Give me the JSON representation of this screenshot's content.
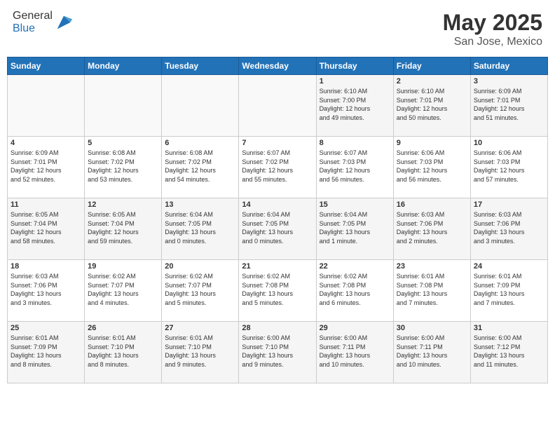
{
  "header": {
    "logo_general": "General",
    "logo_blue": "Blue",
    "month": "May 2025",
    "location": "San Jose, Mexico"
  },
  "days_of_week": [
    "Sunday",
    "Monday",
    "Tuesday",
    "Wednesday",
    "Thursday",
    "Friday",
    "Saturday"
  ],
  "weeks": [
    [
      {
        "day": "",
        "info": ""
      },
      {
        "day": "",
        "info": ""
      },
      {
        "day": "",
        "info": ""
      },
      {
        "day": "",
        "info": ""
      },
      {
        "day": "1",
        "info": "Sunrise: 6:10 AM\nSunset: 7:00 PM\nDaylight: 12 hours\nand 49 minutes."
      },
      {
        "day": "2",
        "info": "Sunrise: 6:10 AM\nSunset: 7:01 PM\nDaylight: 12 hours\nand 50 minutes."
      },
      {
        "day": "3",
        "info": "Sunrise: 6:09 AM\nSunset: 7:01 PM\nDaylight: 12 hours\nand 51 minutes."
      }
    ],
    [
      {
        "day": "4",
        "info": "Sunrise: 6:09 AM\nSunset: 7:01 PM\nDaylight: 12 hours\nand 52 minutes."
      },
      {
        "day": "5",
        "info": "Sunrise: 6:08 AM\nSunset: 7:02 PM\nDaylight: 12 hours\nand 53 minutes."
      },
      {
        "day": "6",
        "info": "Sunrise: 6:08 AM\nSunset: 7:02 PM\nDaylight: 12 hours\nand 54 minutes."
      },
      {
        "day": "7",
        "info": "Sunrise: 6:07 AM\nSunset: 7:02 PM\nDaylight: 12 hours\nand 55 minutes."
      },
      {
        "day": "8",
        "info": "Sunrise: 6:07 AM\nSunset: 7:03 PM\nDaylight: 12 hours\nand 56 minutes."
      },
      {
        "day": "9",
        "info": "Sunrise: 6:06 AM\nSunset: 7:03 PM\nDaylight: 12 hours\nand 56 minutes."
      },
      {
        "day": "10",
        "info": "Sunrise: 6:06 AM\nSunset: 7:03 PM\nDaylight: 12 hours\nand 57 minutes."
      }
    ],
    [
      {
        "day": "11",
        "info": "Sunrise: 6:05 AM\nSunset: 7:04 PM\nDaylight: 12 hours\nand 58 minutes."
      },
      {
        "day": "12",
        "info": "Sunrise: 6:05 AM\nSunset: 7:04 PM\nDaylight: 12 hours\nand 59 minutes."
      },
      {
        "day": "13",
        "info": "Sunrise: 6:04 AM\nSunset: 7:05 PM\nDaylight: 13 hours\nand 0 minutes."
      },
      {
        "day": "14",
        "info": "Sunrise: 6:04 AM\nSunset: 7:05 PM\nDaylight: 13 hours\nand 0 minutes."
      },
      {
        "day": "15",
        "info": "Sunrise: 6:04 AM\nSunset: 7:05 PM\nDaylight: 13 hours\nand 1 minute."
      },
      {
        "day": "16",
        "info": "Sunrise: 6:03 AM\nSunset: 7:06 PM\nDaylight: 13 hours\nand 2 minutes."
      },
      {
        "day": "17",
        "info": "Sunrise: 6:03 AM\nSunset: 7:06 PM\nDaylight: 13 hours\nand 3 minutes."
      }
    ],
    [
      {
        "day": "18",
        "info": "Sunrise: 6:03 AM\nSunset: 7:06 PM\nDaylight: 13 hours\nand 3 minutes."
      },
      {
        "day": "19",
        "info": "Sunrise: 6:02 AM\nSunset: 7:07 PM\nDaylight: 13 hours\nand 4 minutes."
      },
      {
        "day": "20",
        "info": "Sunrise: 6:02 AM\nSunset: 7:07 PM\nDaylight: 13 hours\nand 5 minutes."
      },
      {
        "day": "21",
        "info": "Sunrise: 6:02 AM\nSunset: 7:08 PM\nDaylight: 13 hours\nand 5 minutes."
      },
      {
        "day": "22",
        "info": "Sunrise: 6:02 AM\nSunset: 7:08 PM\nDaylight: 13 hours\nand 6 minutes."
      },
      {
        "day": "23",
        "info": "Sunrise: 6:01 AM\nSunset: 7:08 PM\nDaylight: 13 hours\nand 7 minutes."
      },
      {
        "day": "24",
        "info": "Sunrise: 6:01 AM\nSunset: 7:09 PM\nDaylight: 13 hours\nand 7 minutes."
      }
    ],
    [
      {
        "day": "25",
        "info": "Sunrise: 6:01 AM\nSunset: 7:09 PM\nDaylight: 13 hours\nand 8 minutes."
      },
      {
        "day": "26",
        "info": "Sunrise: 6:01 AM\nSunset: 7:10 PM\nDaylight: 13 hours\nand 8 minutes."
      },
      {
        "day": "27",
        "info": "Sunrise: 6:01 AM\nSunset: 7:10 PM\nDaylight: 13 hours\nand 9 minutes."
      },
      {
        "day": "28",
        "info": "Sunrise: 6:00 AM\nSunset: 7:10 PM\nDaylight: 13 hours\nand 9 minutes."
      },
      {
        "day": "29",
        "info": "Sunrise: 6:00 AM\nSunset: 7:11 PM\nDaylight: 13 hours\nand 10 minutes."
      },
      {
        "day": "30",
        "info": "Sunrise: 6:00 AM\nSunset: 7:11 PM\nDaylight: 13 hours\nand 10 minutes."
      },
      {
        "day": "31",
        "info": "Sunrise: 6:00 AM\nSunset: 7:12 PM\nDaylight: 13 hours\nand 11 minutes."
      }
    ]
  ]
}
